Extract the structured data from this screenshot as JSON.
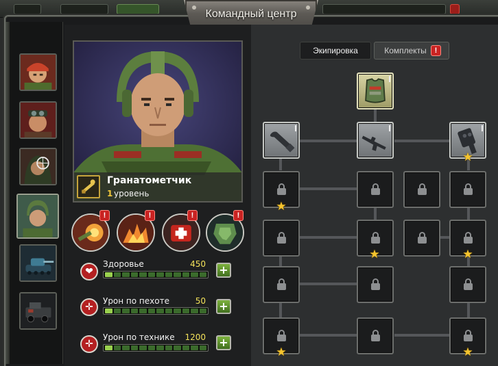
{
  "window": {
    "title": "Командный центр"
  },
  "units": [
    {
      "name": "unit-slot-soldier-1"
    },
    {
      "name": "unit-slot-soldier-2"
    },
    {
      "name": "unit-slot-sniper"
    },
    {
      "name": "unit-slot-grenadier",
      "active": true
    },
    {
      "name": "unit-slot-tank"
    },
    {
      "name": "unit-slot-armored-car"
    }
  ],
  "hero": {
    "name": "Гранатометчик",
    "level_number": "1",
    "level_text": "уровень",
    "icon": "grenade-launcher-icon"
  },
  "abilities": [
    {
      "name": "ability-shot-icon",
      "alert": "!"
    },
    {
      "name": "ability-explosion-icon",
      "alert": "!"
    },
    {
      "name": "ability-medkit-icon",
      "alert": "!"
    },
    {
      "name": "ability-armor-icon",
      "alert": "!"
    }
  ],
  "stats": [
    {
      "label": "Здоровье",
      "value": "450",
      "icon": "heart-icon",
      "fill": 0.1
    },
    {
      "label": "Урон по пехоте",
      "value": "50",
      "icon": "infantry-target-icon",
      "fill": 0.1
    },
    {
      "label": "Урон по технике",
      "value": "1200",
      "icon": "vehicle-target-icon",
      "fill": 0.1
    }
  ],
  "plus_label": "+",
  "tabs": {
    "equipment": "Экипировка",
    "sets": "Комплекты",
    "sets_alert": "!"
  },
  "colors": {
    "accent_green": "#9ad14f",
    "alert_red": "#c92322",
    "level_yellow": "#f3c93b",
    "star_gold": "#f6c52e"
  },
  "stars": "★"
}
